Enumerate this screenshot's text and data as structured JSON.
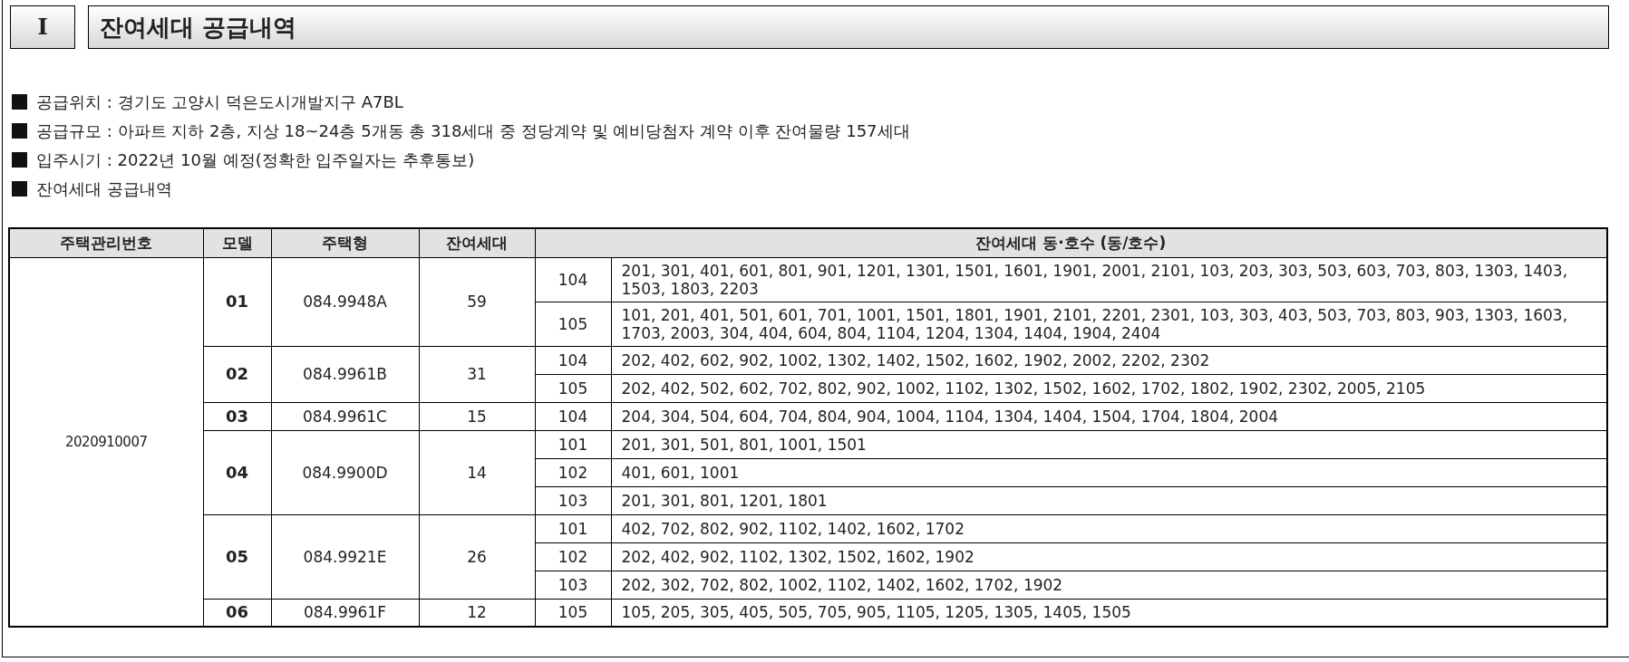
{
  "section": {
    "number": "I",
    "title": "잔여세대 공급내역"
  },
  "bullets": [
    "공급위치 : 경기도 고양시 덕은도시개발지구 A7BL",
    "공급규모 : 아파트 지하 2층, 지상 18~24층 5개동 총 318세대 중 정당계약 및 예비당첨자 계약 이후 잔여물량 157세대",
    "입주시기 : 2022년 10월 예정(정확한 입주일자는 추후통보)",
    "잔여세대 공급내역"
  ],
  "table": {
    "columns": [
      "주택관리번호",
      "모델",
      "주택형",
      "잔여세대",
      "잔여세대 동·호수 (동/호수)"
    ],
    "management_number": "2020910007",
    "models": [
      {
        "model": "01",
        "type": "084.9948A",
        "remaining": "59",
        "blocks": [
          {
            "dong": "104",
            "units": "201, 301, 401, 601, 801, 901, 1201, 1301, 1501, 1601, 1901, 2001, 2101, 103, 203, 303, 503, 603, 703, 803, 1303, 1403, 1503, 1803, 2203"
          },
          {
            "dong": "105",
            "units": "101, 201, 401, 501, 601, 701, 1001, 1501, 1801, 1901, 2101, 2201, 2301, 103, 303, 403, 503, 703, 803, 903, 1303, 1603, 1703, 2003, 304, 404, 604, 804, 1104, 1204, 1304, 1404, 1904, 2404"
          }
        ]
      },
      {
        "model": "02",
        "type": "084.9961B",
        "remaining": "31",
        "blocks": [
          {
            "dong": "104",
            "units": "202, 402, 602, 902, 1002, 1302, 1402, 1502, 1602, 1902, 2002, 2202, 2302"
          },
          {
            "dong": "105",
            "units": "202, 402, 502, 602, 702, 802, 902, 1002, 1102, 1302, 1502, 1602, 1702, 1802, 1902, 2302, 2005, 2105"
          }
        ]
      },
      {
        "model": "03",
        "type": "084.9961C",
        "remaining": "15",
        "blocks": [
          {
            "dong": "104",
            "units": "204, 304, 504, 604, 704, 804, 904, 1004, 1104, 1304, 1404, 1504, 1704, 1804, 2004"
          }
        ]
      },
      {
        "model": "04",
        "type": "084.9900D",
        "remaining": "14",
        "blocks": [
          {
            "dong": "101",
            "units": "201, 301, 501, 801, 1001, 1501"
          },
          {
            "dong": "102",
            "units": "401, 601, 1001"
          },
          {
            "dong": "103",
            "units": "201, 301, 801, 1201, 1801"
          }
        ]
      },
      {
        "model": "05",
        "type": "084.9921E",
        "remaining": "26",
        "blocks": [
          {
            "dong": "101",
            "units": "402, 702, 802, 902, 1102, 1402, 1602, 1702"
          },
          {
            "dong": "102",
            "units": "202, 402, 902, 1102, 1302, 1502, 1602, 1902"
          },
          {
            "dong": "103",
            "units": "202, 302, 702, 802, 1002, 1102, 1402, 1602, 1702, 1902"
          }
        ]
      },
      {
        "model": "06",
        "type": "084.9961F",
        "remaining": "12",
        "blocks": [
          {
            "dong": "105",
            "units": "105, 205, 305, 405, 505, 705, 905, 1105, 1205, 1305, 1405, 1505"
          }
        ]
      }
    ]
  }
}
